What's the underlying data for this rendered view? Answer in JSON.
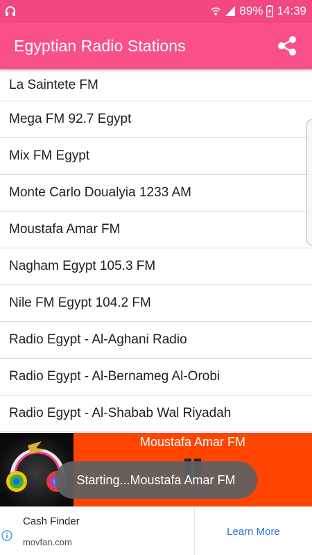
{
  "status_bar": {
    "battery": "89%",
    "time": "14:39",
    "left_icon": "headphones-icon",
    "icons": [
      "wifi-call-icon",
      "signal-icon",
      "battery-charging-icon"
    ]
  },
  "app_bar": {
    "title": "Egyptian Radio Stations",
    "share_icon": "share-icon",
    "background": "#f9508a",
    "status_background": "#f0487f"
  },
  "stations": [
    "La Saintete FM",
    "Mega FM 92.7 Egypt",
    "Mix FM Egypt",
    "Monte Carlo Doualyia 1233 AM",
    "Moustafa Amar FM",
    "Nagham Egypt 105.3 FM",
    "Nile FM Egypt 104.2 FM",
    "Radio Egypt - Al-Aghani Radio",
    "Radio Egypt - Al-Bernameg Al-Orobi",
    "Radio Egypt - Al-Shabab Wal Riyadah"
  ],
  "player": {
    "now_playing": "Moustafa Amar FM",
    "control_icon": "pause-icon",
    "background": "#ff4500"
  },
  "toast": {
    "text": "Starting...Moustafa Amar FM"
  },
  "ad": {
    "title": "Cash Finder",
    "domain": "movfan.com",
    "cta": "Learn More",
    "info_icon": "ad-info-icon"
  }
}
